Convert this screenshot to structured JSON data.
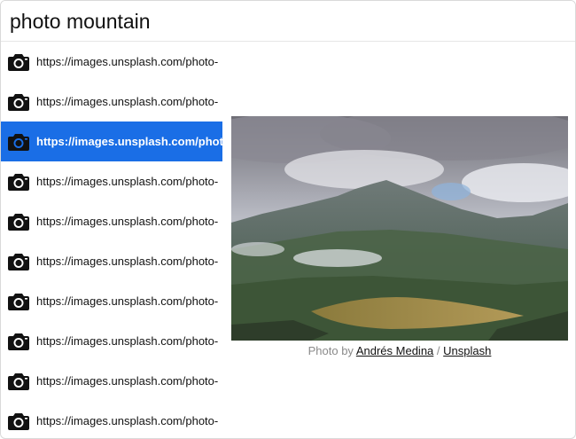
{
  "search": {
    "query": "photo mountain"
  },
  "results": {
    "icon": "camera-icon",
    "selected_index": 2,
    "items": [
      {
        "label": "https://images.unsplash.com/photo-"
      },
      {
        "label": "https://images.unsplash.com/photo-"
      },
      {
        "label": "https://images.unsplash.com/photo-"
      },
      {
        "label": "https://images.unsplash.com/photo-"
      },
      {
        "label": "https://images.unsplash.com/photo-"
      },
      {
        "label": "https://images.unsplash.com/photo-"
      },
      {
        "label": "https://images.unsplash.com/photo-"
      },
      {
        "label": "https://images.unsplash.com/photo-"
      },
      {
        "label": "https://images.unsplash.com/photo-"
      },
      {
        "label": "https://images.unsplash.com/photo-"
      }
    ]
  },
  "preview": {
    "image": "mountain-landscape-photo",
    "credit_prefix": "Photo by",
    "author": "Andrés Medina",
    "separator": "/",
    "source": "Unsplash"
  },
  "colors": {
    "selection": "#1a6ee6",
    "credit_text": "#8a8a8a"
  }
}
